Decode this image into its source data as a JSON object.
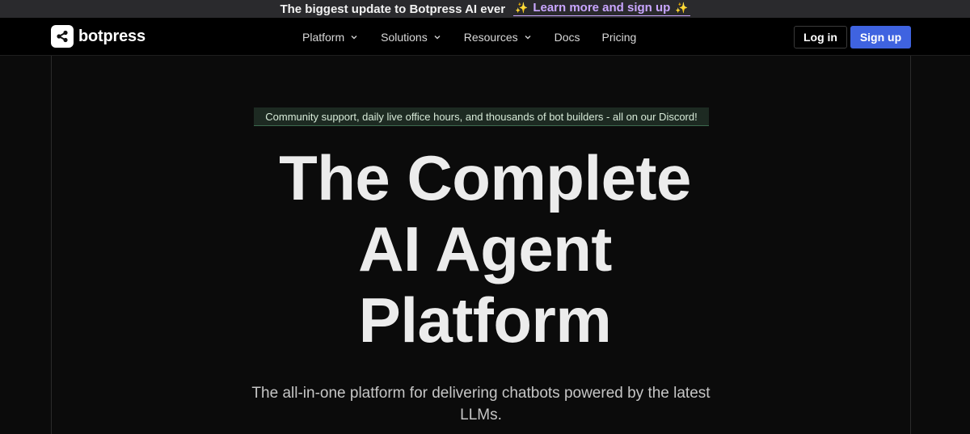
{
  "announcement": {
    "text": "The biggest update to Botpress AI ever",
    "cta_label": "Learn more and sign up",
    "sparkle_icon": "sparkles-icon"
  },
  "nav": {
    "brand": "botpress",
    "items": [
      {
        "label": "Platform",
        "has_dropdown": true
      },
      {
        "label": "Solutions",
        "has_dropdown": true
      },
      {
        "label": "Resources",
        "has_dropdown": true
      },
      {
        "label": "Docs",
        "has_dropdown": false
      },
      {
        "label": "Pricing",
        "has_dropdown": false
      }
    ],
    "login_label": "Log in",
    "signup_label": "Sign up"
  },
  "hero": {
    "discord_banner": "Community support, daily live office hours, and thousands of bot builders - all on our Discord!",
    "headline_lines": [
      "The Complete",
      "AI Agent",
      "Platform"
    ],
    "subhead": "The all-in-one platform for delivering chatbots powered by the latest LLMs."
  },
  "colors": {
    "background": "#0b0b0b",
    "announcement_bg": "#2a2a2d",
    "cta_purple": "#c9a6ff",
    "signup_blue": "#3f63e0",
    "discord_banner_bg": "#1d2a22"
  }
}
